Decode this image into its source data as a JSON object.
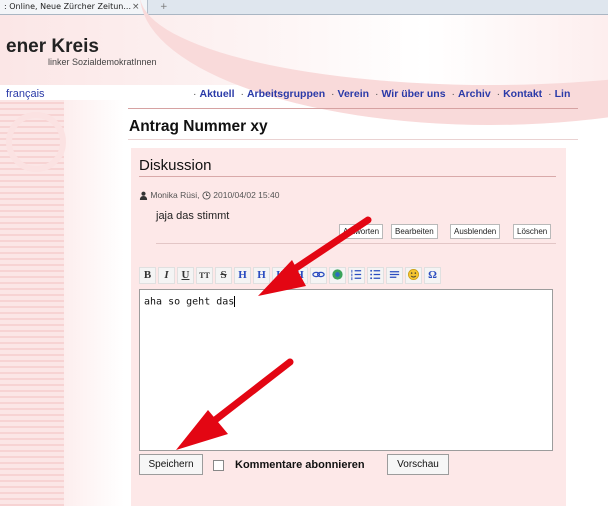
{
  "browser": {
    "tab_title": ": Online, Neue Zürcher Zeitun...",
    "tab_close": "×",
    "new_tab": "+"
  },
  "site": {
    "title": "ener Kreis",
    "subtitle": "linker SozialdemokratInnen",
    "language_link": "français",
    "nav": [
      "Aktuell",
      "Arbeitsgruppen",
      "Verein",
      "Wir über uns",
      "Archiv",
      "Kontakt",
      "Lin"
    ]
  },
  "page": {
    "title": "Antrag Nummer xy"
  },
  "discussion": {
    "heading": "Diskussion",
    "comment": {
      "author": "Monika Rüsi,",
      "date": "2010/04/02 15:40",
      "text": "jaja das stimmt",
      "actions": {
        "reply": "Antworten",
        "edit": "Bearbeiten",
        "hide": "Ausblenden",
        "delete": "Löschen"
      }
    },
    "editor": {
      "toolbar": [
        "B",
        "I",
        "U",
        "TT",
        "S",
        "H",
        "H",
        "H",
        "H",
        "link",
        "image",
        "ol",
        "ul",
        "quote",
        "smiley",
        "Ω"
      ],
      "content": "aha so geht das"
    },
    "save_label": "Speichern",
    "subscribe_label": "Kommentare abonnieren",
    "preview_label": "Vorschau"
  },
  "colors": {
    "accent_red": "#e30613",
    "link_blue": "#2a3aa8",
    "box_pink": "#fde8e8"
  }
}
